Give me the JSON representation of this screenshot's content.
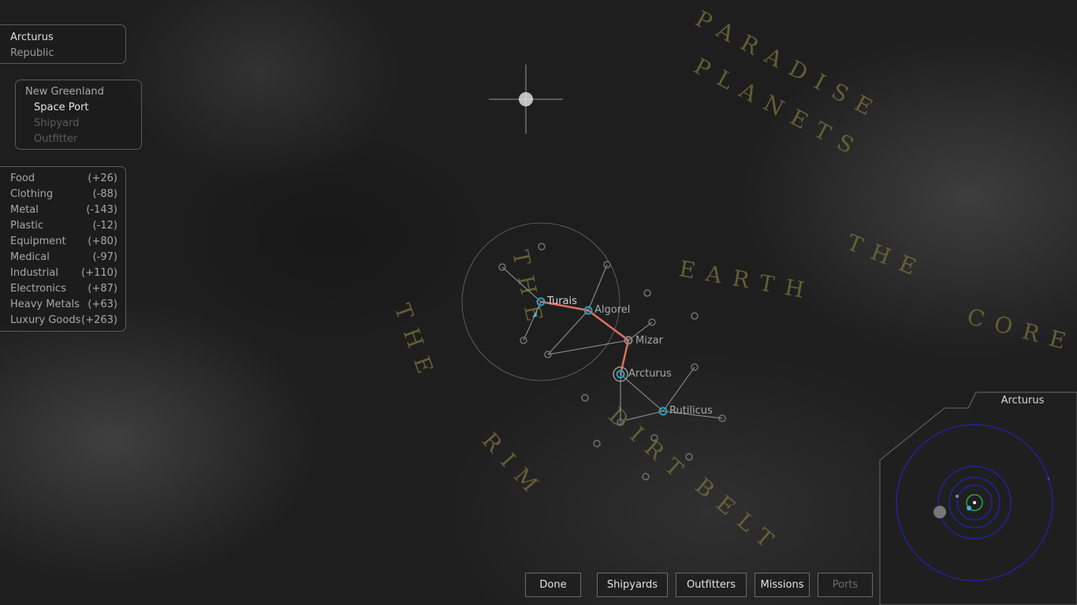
{
  "system_panel": {
    "system": "Arcturus",
    "government": "Republic"
  },
  "planet_panel": {
    "planet": "New Greenland",
    "services": [
      {
        "label": "Space Port",
        "enabled": true
      },
      {
        "label": "Shipyard",
        "enabled": false
      },
      {
        "label": "Outfitter",
        "enabled": false
      }
    ]
  },
  "trade_panel": {
    "items": [
      {
        "name": "Food",
        "delta": "(+26)"
      },
      {
        "name": "Clothing",
        "delta": "(-88)"
      },
      {
        "name": "Metal",
        "delta": "(-143)"
      },
      {
        "name": "Plastic",
        "delta": "(-12)"
      },
      {
        "name": "Equipment",
        "delta": "(+80)"
      },
      {
        "name": "Medical",
        "delta": "(-97)"
      },
      {
        "name": "Industrial",
        "delta": "(+110)"
      },
      {
        "name": "Electronics",
        "delta": "(+87)"
      },
      {
        "name": "Heavy Metals",
        "delta": "(+63)"
      },
      {
        "name": "Luxury Goods",
        "delta": "(+263)"
      }
    ]
  },
  "map": {
    "systems": {
      "turais": "Turais",
      "algorel": "Algorel",
      "mizar": "Mizar",
      "arcturus": "Arcturus",
      "rutilicus": "Rutilicus"
    },
    "region_labels": [
      "PARADISE",
      "PLANETS",
      "EARTH",
      "THE",
      "CORE",
      "THE",
      "DIRT",
      "BELT",
      "THE",
      "RIM"
    ],
    "colors": {
      "route": "#e0705e",
      "system_ring": "#2e9fc4",
      "link": "#b8b8b8"
    }
  },
  "minimap": {
    "title": "Arcturus"
  },
  "buttons": {
    "done": "Done",
    "shipyards": "Shipyards",
    "outfitters": "Outfitters",
    "missions": "Missions",
    "ports": "Ports"
  }
}
